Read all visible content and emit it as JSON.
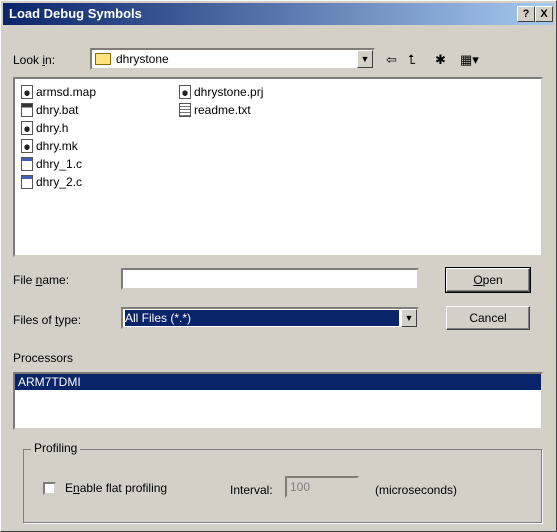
{
  "window": {
    "title": "Load Debug Symbols",
    "help_label": "?",
    "close_label": "X"
  },
  "lookin": {
    "label_pre": "Look ",
    "label_u": "i",
    "label_post": "n:",
    "value": "dhrystone"
  },
  "toolbar": {
    "back": "⇦",
    "up": "⮤",
    "new": "✱",
    "view": "▦▾"
  },
  "files": [
    {
      "name": "armsd.map",
      "icon": "app"
    },
    {
      "name": "dhry.bat",
      "icon": "exe"
    },
    {
      "name": "dhry.h",
      "icon": "app"
    },
    {
      "name": "dhry.mk",
      "icon": "app"
    },
    {
      "name": "dhry_1.c",
      "icon": "src"
    },
    {
      "name": "dhry_2.c",
      "icon": "src"
    },
    {
      "name": "dhrystone.prj",
      "icon": "app"
    },
    {
      "name": "readme.txt",
      "icon": "txt"
    }
  ],
  "filename": {
    "label_pre": "File ",
    "label_u": "n",
    "label_post": "ame:",
    "value": ""
  },
  "filetype": {
    "label_pre": "Files of ",
    "label_u": "t",
    "label_post": "ype:",
    "value": "All Files (*.*)"
  },
  "buttons": {
    "open_u": "O",
    "open_rest": "pen",
    "cancel": "Cancel"
  },
  "processors": {
    "label": "Processors",
    "items": [
      "ARM7TDMI"
    ]
  },
  "profiling": {
    "group_label": "Profiling",
    "enable_pre": "E",
    "enable_u": "n",
    "enable_post": "able flat profiling",
    "interval_label": "Interval:",
    "interval_value": "100",
    "unit": "(microseconds)"
  }
}
